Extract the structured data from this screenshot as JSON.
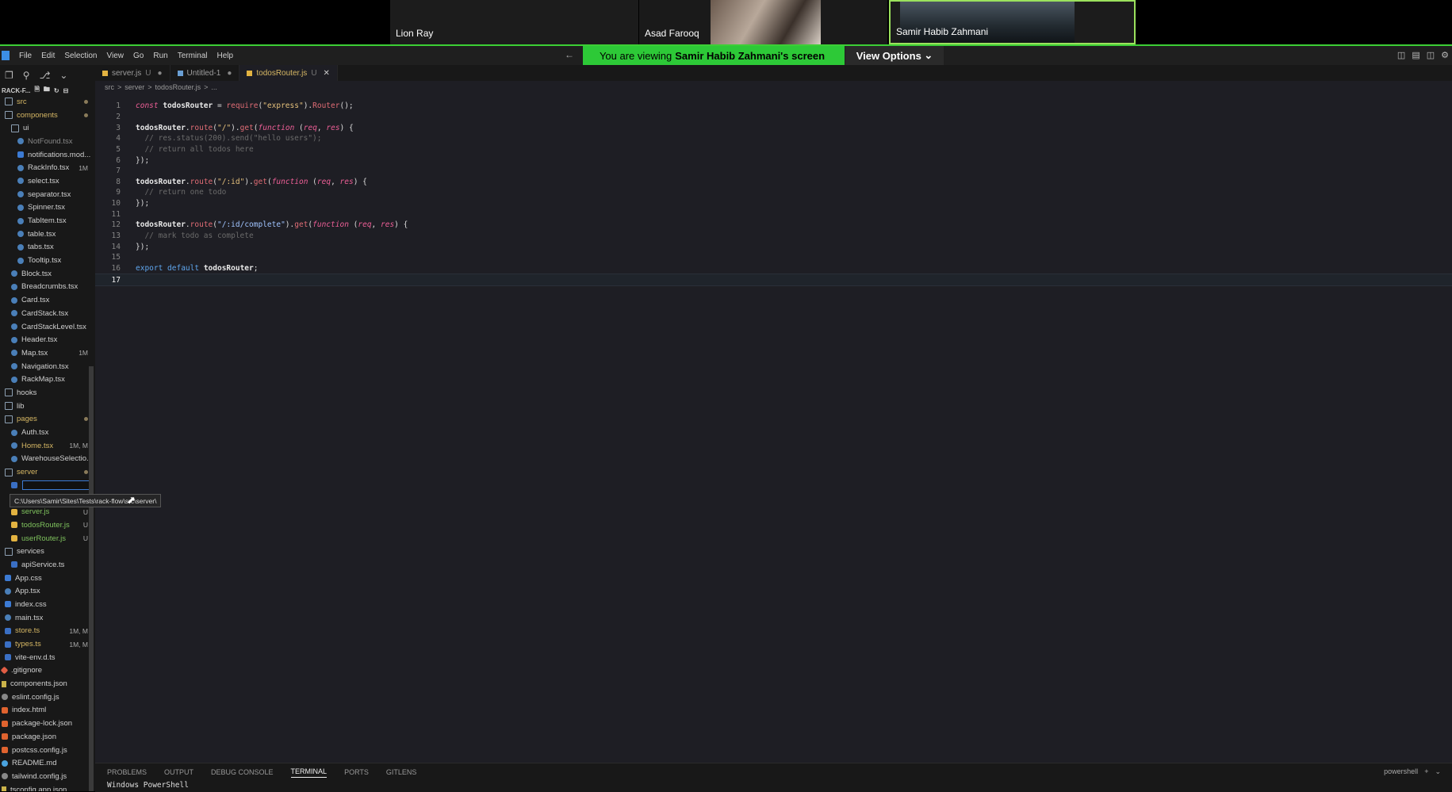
{
  "participants": [
    {
      "name": "Lion Ray"
    },
    {
      "name": "Asad Farooq"
    },
    {
      "name": "Samir Habib Zahmani"
    }
  ],
  "viewing_banner": {
    "prefix": "You are viewing",
    "owner": "Samir Habib Zahmani's screen"
  },
  "view_options_label": "View Options",
  "menu": [
    "File",
    "Edit",
    "Selection",
    "View",
    "Go",
    "Run",
    "Terminal",
    "Help"
  ],
  "explorer": {
    "title": "RACK-F...",
    "tree": [
      {
        "label": "src",
        "type": "folder",
        "indent": 0,
        "cls": "yellowtxt",
        "dot": true
      },
      {
        "label": "components",
        "type": "folder",
        "indent": 0,
        "cls": "yellowtxt",
        "dot": true
      },
      {
        "label": "ui",
        "type": "folder",
        "indent": 1
      },
      {
        "label": "NotFound.tsx",
        "type": "c-tsx",
        "indent": 2,
        "faded": true
      },
      {
        "label": "notifications.mod...",
        "type": "c-css",
        "indent": 2
      },
      {
        "label": "RackInfo.tsx",
        "type": "c-tsx",
        "indent": 2,
        "badge": "1M"
      },
      {
        "label": "select.tsx",
        "type": "c-tsx",
        "indent": 2
      },
      {
        "label": "separator.tsx",
        "type": "c-tsx",
        "indent": 2
      },
      {
        "label": "Spinner.tsx",
        "type": "c-tsx",
        "indent": 2
      },
      {
        "label": "TabItem.tsx",
        "type": "c-tsx",
        "indent": 2
      },
      {
        "label": "table.tsx",
        "type": "c-tsx",
        "indent": 2
      },
      {
        "label": "tabs.tsx",
        "type": "c-tsx",
        "indent": 2
      },
      {
        "label": "Tooltip.tsx",
        "type": "c-tsx",
        "indent": 2
      },
      {
        "label": "Block.tsx",
        "type": "c-tsx",
        "indent": 1
      },
      {
        "label": "Breadcrumbs.tsx",
        "type": "c-tsx",
        "indent": 1
      },
      {
        "label": "Card.tsx",
        "type": "c-tsx",
        "indent": 1
      },
      {
        "label": "CardStack.tsx",
        "type": "c-tsx",
        "indent": 1
      },
      {
        "label": "CardStackLevel.tsx",
        "type": "c-tsx",
        "indent": 1
      },
      {
        "label": "Header.tsx",
        "type": "c-tsx",
        "indent": 1
      },
      {
        "label": "Map.tsx",
        "type": "c-tsx",
        "indent": 1,
        "badge": "1M"
      },
      {
        "label": "Navigation.tsx",
        "type": "c-tsx",
        "indent": 1
      },
      {
        "label": "RackMap.tsx",
        "type": "c-tsx",
        "indent": 1
      },
      {
        "label": "hooks",
        "type": "folder",
        "indent": 0
      },
      {
        "label": "lib",
        "type": "folder",
        "indent": 0
      },
      {
        "label": "pages",
        "type": "folder",
        "indent": 0,
        "cls": "yellowtxt",
        "dot": true
      },
      {
        "label": "Auth.tsx",
        "type": "c-tsx",
        "indent": 1
      },
      {
        "label": "Home.tsx",
        "type": "c-tsx",
        "indent": 1,
        "badge": "1M, M",
        "cls": "yellowtxt"
      },
      {
        "label": "WarehouseSelectio...",
        "type": "c-tsx",
        "indent": 1
      },
      {
        "label": "server",
        "type": "folder",
        "indent": 0,
        "cls": "yellowtxt",
        "dot": true
      },
      {
        "label": "",
        "type": "c-ts",
        "indent": 1,
        "rename": true
      },
      {
        "label": "",
        "type": "spacer",
        "indent": 1
      },
      {
        "label": "server.js",
        "type": "c-js",
        "indent": 1,
        "badge": "U",
        "cls": "green"
      },
      {
        "label": "todosRouter.js",
        "type": "c-js",
        "indent": 1,
        "badge": "U",
        "cls": "green"
      },
      {
        "label": "userRouter.js",
        "type": "c-js",
        "indent": 1,
        "badge": "U",
        "cls": "green"
      },
      {
        "label": "services",
        "type": "folder",
        "indent": 0
      },
      {
        "label": "apiService.ts",
        "type": "c-ts",
        "indent": 1
      },
      {
        "label": "App.css",
        "type": "c-css",
        "indent": 0
      },
      {
        "label": "App.tsx",
        "type": "c-tsx",
        "indent": 0
      },
      {
        "label": "index.css",
        "type": "c-css",
        "indent": 0
      },
      {
        "label": "main.tsx",
        "type": "c-tsx",
        "indent": 0
      },
      {
        "label": "store.ts",
        "type": "c-ts",
        "indent": 0,
        "badge": "1M, M",
        "cls": "yellowtxt"
      },
      {
        "label": "types.ts",
        "type": "c-ts",
        "indent": 0,
        "badge": "1M, M",
        "cls": "yellowtxt"
      },
      {
        "label": "vite-env.d.ts",
        "type": "c-ts",
        "indent": 0
      },
      {
        "label": ".gitignore",
        "type": "c-git",
        "indent": -1
      },
      {
        "label": "components.json",
        "type": "c-json",
        "indent": -1
      },
      {
        "label": "eslint.config.js",
        "type": "c-gray",
        "indent": -1
      },
      {
        "label": "index.html",
        "type": "c-html",
        "indent": -1
      },
      {
        "label": "package-lock.json",
        "type": "c-html",
        "indent": -1
      },
      {
        "label": "package.json",
        "type": "c-html",
        "indent": -1
      },
      {
        "label": "postcss.config.js",
        "type": "c-html",
        "indent": -1
      },
      {
        "label": "README.md",
        "type": "c-md",
        "indent": -1
      },
      {
        "label": "tailwind.config.js",
        "type": "c-gray",
        "indent": -1
      },
      {
        "label": "tsconfig.app.json",
        "type": "c-json",
        "indent": -1
      }
    ],
    "tooltip": "C:\\Users\\Samir\\Sites\\Tests\\rack-flow\\src\\server\\"
  },
  "tabs": [
    {
      "label": "server.js",
      "status": "U",
      "dirty": true,
      "active": false
    },
    {
      "label": "Untitled-1",
      "status": "",
      "dirty": true,
      "active": false
    },
    {
      "label": "todosRouter.js",
      "status": "U",
      "dirty": false,
      "active": true
    }
  ],
  "breadcrumbs": [
    "src",
    ">",
    "server",
    ">",
    "todosRouter.js",
    ">",
    "..."
  ],
  "code": [
    [
      [
        "kw",
        "const "
      ],
      [
        "id",
        "todosRouter"
      ],
      [
        "punc",
        " = "
      ],
      [
        "fn",
        "require"
      ],
      [
        "punc",
        "("
      ],
      [
        "str",
        "\"express\""
      ],
      [
        "punc",
        ")."
      ],
      [
        "fn",
        "Router"
      ],
      [
        "punc",
        "();"
      ]
    ],
    [],
    [
      [
        "id",
        "todosRouter"
      ],
      [
        "punc",
        "."
      ],
      [
        "fn",
        "route"
      ],
      [
        "punc",
        "("
      ],
      [
        "str",
        "\"/\""
      ],
      [
        "punc",
        ")."
      ],
      [
        "fn",
        "get"
      ],
      [
        "punc",
        "("
      ],
      [
        "kw",
        "function "
      ],
      [
        "punc",
        "("
      ],
      [
        "param",
        "req"
      ],
      [
        "punc",
        ", "
      ],
      [
        "param",
        "res"
      ],
      [
        "punc",
        ") {"
      ]
    ],
    [
      [
        "cmt",
        "  // res.status(200).send(\"hello users\");"
      ]
    ],
    [
      [
        "cmt",
        "  // return all todos here"
      ]
    ],
    [
      [
        "punc",
        "});"
      ]
    ],
    [],
    [
      [
        "id",
        "todosRouter"
      ],
      [
        "punc",
        "."
      ],
      [
        "fn",
        "route"
      ],
      [
        "punc",
        "("
      ],
      [
        "str",
        "\"/:id\""
      ],
      [
        "punc",
        ")."
      ],
      [
        "fn",
        "get"
      ],
      [
        "punc",
        "("
      ],
      [
        "kw",
        "function "
      ],
      [
        "punc",
        "("
      ],
      [
        "param",
        "req"
      ],
      [
        "punc",
        ", "
      ],
      [
        "param",
        "res"
      ],
      [
        "punc",
        ") {"
      ]
    ],
    [
      [
        "cmt",
        "  // return one todo"
      ]
    ],
    [
      [
        "punc",
        "});"
      ]
    ],
    [],
    [
      [
        "id",
        "todosRouter"
      ],
      [
        "punc",
        "."
      ],
      [
        "fn",
        "route"
      ],
      [
        "punc",
        "("
      ],
      [
        "str2",
        "\"/:id/complete\""
      ],
      [
        "punc",
        ")."
      ],
      [
        "fn",
        "get"
      ],
      [
        "punc",
        "("
      ],
      [
        "kw",
        "function "
      ],
      [
        "punc",
        "("
      ],
      [
        "param",
        "req"
      ],
      [
        "punc",
        ", "
      ],
      [
        "param",
        "res"
      ],
      [
        "punc",
        ") {"
      ]
    ],
    [
      [
        "cmt",
        "  // mark todo as complete"
      ]
    ],
    [
      [
        "punc",
        "});"
      ]
    ],
    [],
    [
      [
        "kw2",
        "export "
      ],
      [
        "kw2",
        "default "
      ],
      [
        "id",
        "todosRouter"
      ],
      [
        "punc",
        ";"
      ]
    ],
    []
  ],
  "current_line": 17,
  "panel": {
    "tabs": [
      "PROBLEMS",
      "OUTPUT",
      "DEBUG CONSOLE",
      "TERMINAL",
      "PORTS",
      "GITLENS"
    ],
    "active_tab": "TERMINAL",
    "shell_label": "powershell",
    "terminal_text": "Windows PowerShell"
  }
}
